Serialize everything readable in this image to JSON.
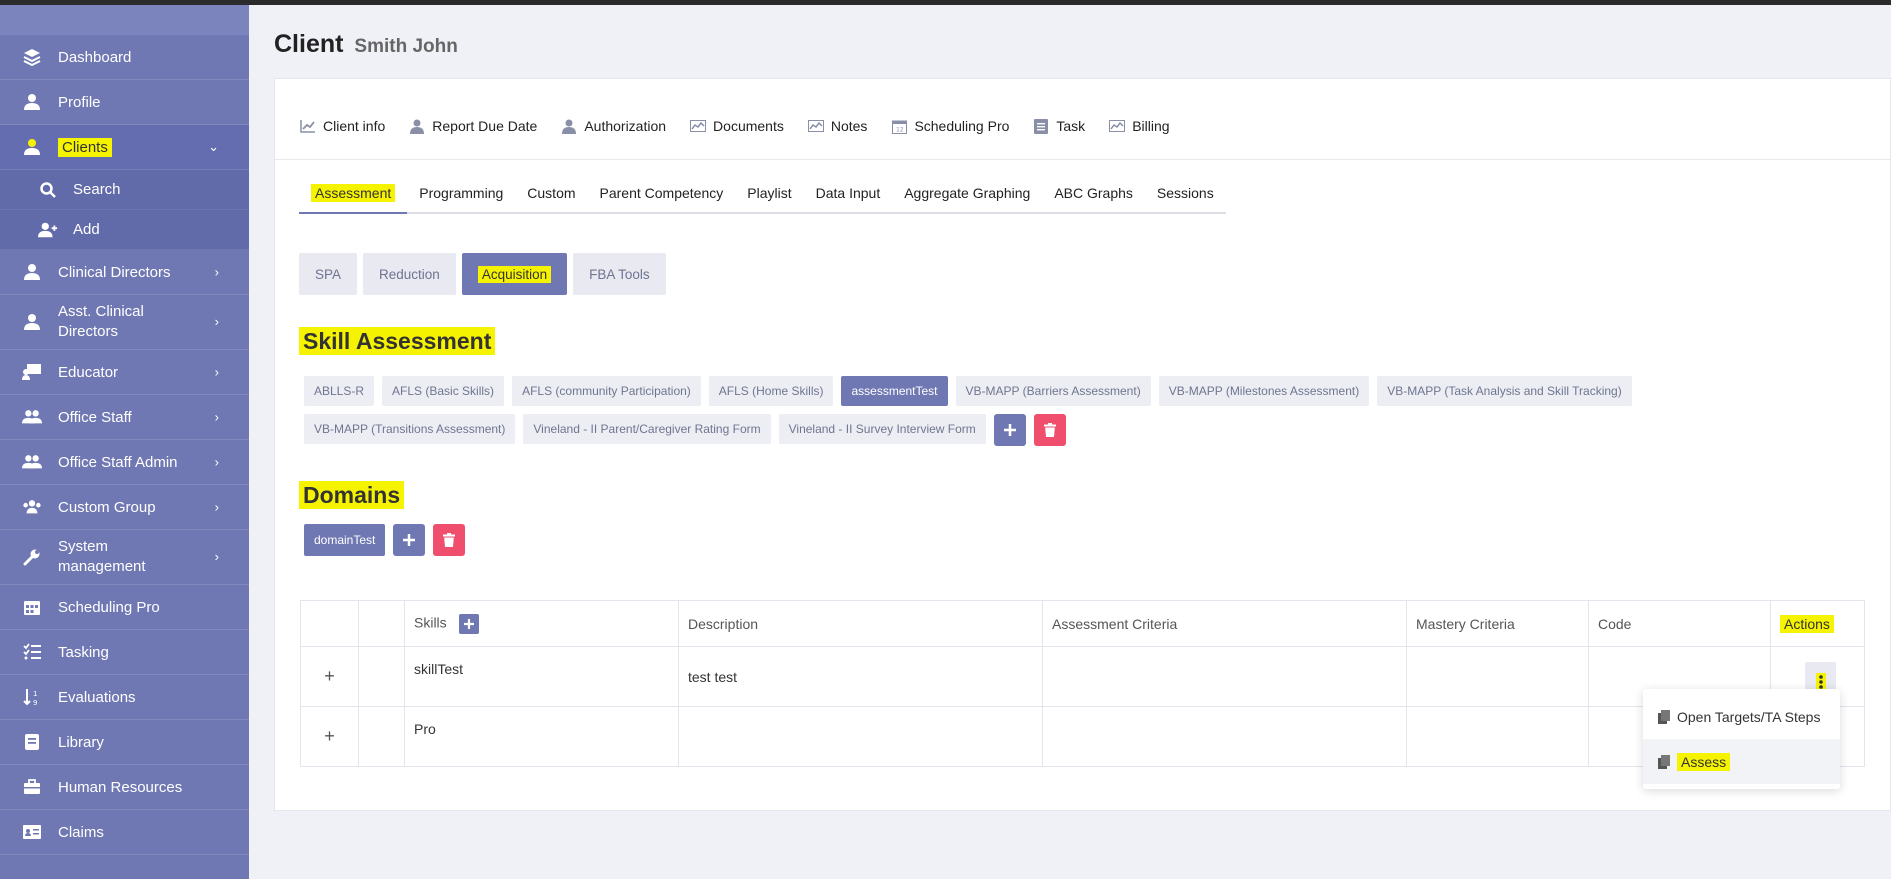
{
  "sidebar": {
    "items": [
      {
        "label": "Dashboard"
      },
      {
        "label": "Profile"
      },
      {
        "label": "Clients"
      },
      {
        "label": "Clinical Directors"
      },
      {
        "label": "Asst. Clinical Directors"
      },
      {
        "label": "Educator"
      },
      {
        "label": "Office Staff"
      },
      {
        "label": "Office Staff Admin"
      },
      {
        "label": "Custom Group"
      },
      {
        "label": "System management"
      },
      {
        "label": "Scheduling Pro"
      },
      {
        "label": "Tasking"
      },
      {
        "label": "Evaluations"
      },
      {
        "label": "Library"
      },
      {
        "label": "Human Resources"
      },
      {
        "label": "Claims"
      }
    ],
    "clients_sub": [
      {
        "label": "Search"
      },
      {
        "label": "Add"
      }
    ]
  },
  "page": {
    "title": "Client",
    "subtitle": "Smith John"
  },
  "top_tabs": [
    {
      "label": "Client info"
    },
    {
      "label": "Report Due Date"
    },
    {
      "label": "Authorization"
    },
    {
      "label": "Documents"
    },
    {
      "label": "Notes"
    },
    {
      "label": "Scheduling Pro"
    },
    {
      "label": "Task"
    },
    {
      "label": "Billing"
    }
  ],
  "sub_tabs": [
    {
      "label": "Assessment"
    },
    {
      "label": "Programming"
    },
    {
      "label": "Custom"
    },
    {
      "label": "Parent Competency"
    },
    {
      "label": "Playlist"
    },
    {
      "label": "Data Input"
    },
    {
      "label": "Aggregate Graphing"
    },
    {
      "label": "ABC Graphs"
    },
    {
      "label": "Sessions"
    }
  ],
  "pills": [
    {
      "label": "SPA"
    },
    {
      "label": "Reduction"
    },
    {
      "label": "Acquisition"
    },
    {
      "label": "FBA Tools"
    }
  ],
  "skill_assessment": {
    "heading": "Skill Assessment",
    "chips": [
      {
        "label": "ABLLS-R"
      },
      {
        "label": "AFLS (Basic Skills)"
      },
      {
        "label": "AFLS (community Participation)"
      },
      {
        "label": "AFLS (Home Skills)"
      },
      {
        "label": "assessmentTest"
      },
      {
        "label": "VB-MAPP (Barriers Assessment)"
      },
      {
        "label": "VB-MAPP (Milestones Assessment)"
      },
      {
        "label": "VB-MAPP (Task Analysis and Skill Tracking)"
      },
      {
        "label": "VB-MAPP (Transitions Assessment)"
      },
      {
        "label": "Vineland - II Parent/Caregiver Rating Form"
      },
      {
        "label": "Vineland - II Survey Interview Form"
      }
    ]
  },
  "domains": {
    "heading": "Domains",
    "chips": [
      {
        "label": "domainTest"
      }
    ]
  },
  "table": {
    "headers": {
      "skills": "Skills",
      "description": "Description",
      "assessment_criteria": "Assessment Criteria",
      "mastery_criteria": "Mastery Criteria",
      "code": "Code",
      "actions": "Actions"
    },
    "rows": [
      {
        "expand": "+",
        "skill": "skillTest",
        "description": "test test"
      },
      {
        "expand": "+",
        "skill": "Pro",
        "description": ""
      }
    ]
  },
  "action_menu": {
    "items": [
      {
        "label": "Open Targets/TA Steps"
      },
      {
        "label": "Assess"
      }
    ]
  },
  "colors": {
    "sidebar": "#6f78b3",
    "accent": "#6f78b3",
    "danger": "#ef4e6c",
    "highlight": "#f6f300"
  }
}
